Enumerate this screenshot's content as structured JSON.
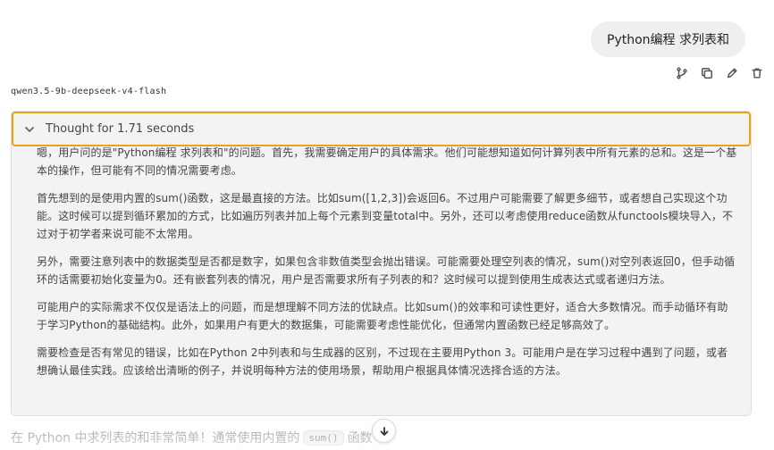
{
  "user_message": {
    "text": "Python编程 求列表和"
  },
  "message_actions": [
    {
      "icon": "branch-icon"
    },
    {
      "icon": "copy-icon"
    },
    {
      "icon": "edit-icon"
    },
    {
      "icon": "trash-icon"
    }
  ],
  "model": {
    "name": "qwen3.5-9b-deepseek-v4-flash"
  },
  "thought": {
    "title": "Thought for 1.71 seconds",
    "paragraphs": [
      "嗯，用户问的是\"Python编程 求列表和\"的问题。首先，我需要确定用户的具体需求。他们可能想知道如何计算列表中所有元素的总和。这是一个基本的操作，但可能有不同的情况需要考虑。",
      "首先想到的是使用内置的sum()函数，这是最直接的方法。比如sum([1,2,3])会返回6。不过用户可能需要了解更多细节，或者想自己实现这个功能。这时候可以提到循环累加的方式，比如遍历列表并加上每个元素到变量total中。另外，还可以考虑使用reduce函数从functools模块导入，不过对于初学者来说可能不太常用。",
      "另外，需要注意列表中的数据类型是否都是数字，如果包含非数值类型会抛出错误。可能需要处理空列表的情况，sum()对空列表返回0，但手动循环的话需要初始化变量为0。还有嵌套列表的情况，用户是否需要求所有子列表的和？这时候可以提到使用生成表达式或者递归方法。",
      "可能用户的实际需求不仅仅是语法上的问题，而是想理解不同方法的优缺点。比如sum()的效率和可读性更好，适合大多数情况。而手动循环有助于学习Python的基础结构。此外，如果用户有更大的数据集，可能需要考虑性能优化，但通常内置函数已经足够高效了。",
      "需要检查是否有常见的错误，比如在Python 2中列表和与生成器的区别，不过现在主要用Python 3。可能用户是在学习过程中遇到了问题，或者想确认最佳实践。应该给出清晰的例子，并说明每种方法的使用场景，帮助用户根据具体情况选择合适的方法。"
    ]
  },
  "answer": {
    "prefix": "在 Python 中求列表的和非常简单！通常使用内置的",
    "code": "sum()",
    "suffix": "函数"
  },
  "colors": {
    "focus_border": "#e8a317",
    "panel_bg": "#f3f3f3",
    "bubble_bg": "#efefef"
  }
}
